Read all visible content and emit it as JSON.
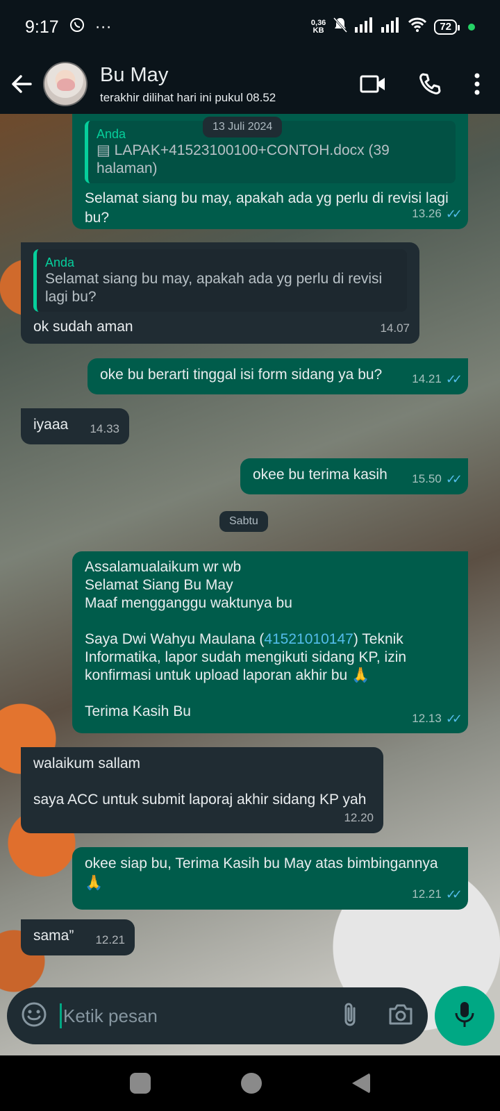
{
  "status_bar": {
    "time": "9:17",
    "more": "···",
    "net_speed": "0,36",
    "net_unit": "KB",
    "battery": "72"
  },
  "header": {
    "contact_name": "Bu May",
    "last_seen": "terakhir dilihat hari ini pukul 08.52"
  },
  "chat": {
    "date_chips": [
      "13 Juli 2024",
      "Sabtu"
    ],
    "messages": [
      {
        "dir": "out",
        "quote_author": "Anda",
        "quote_text": "▤ LAPAK+41523100100+CONTOH.docx (39 halaman)",
        "text": "Selamat siang bu may, apakah ada yg perlu di revisi lagi bu?",
        "time": "13.26",
        "ticks": "✓✓"
      },
      {
        "dir": "in",
        "quote_author": "Anda",
        "quote_text": "Selamat siang bu may, apakah ada yg perlu di revisi lagi bu?",
        "text": "ok sudah aman",
        "time": "14.07"
      },
      {
        "dir": "out",
        "text": "oke bu berarti tinggal isi form sidang ya bu?",
        "time": "14.21",
        "ticks": "✓✓"
      },
      {
        "dir": "in",
        "text": "iyaaa",
        "time": "14.33"
      },
      {
        "dir": "out",
        "text": "okee bu terima kasih",
        "time": "15.50",
        "ticks": "✓✓"
      },
      {
        "dir": "out",
        "lines": [
          "Assalamualaikum wr wb",
          "Selamat Siang Bu May",
          "Maaf mengganggu waktunya bu",
          "",
          "Saya Dwi Wahyu Maulana (",
          "41521010147",
          ") Teknik Informatika, lapor sudah mengikuti sidang KP, izin konfirmasi untuk upload laporan akhir bu 🙏",
          "",
          "Terima Kasih Bu"
        ],
        "time": "12.13",
        "ticks": "✓✓"
      },
      {
        "dir": "in",
        "lines": [
          "walaikum sallam",
          "",
          "saya ACC untuk submit laporaj akhir sidang KP yah"
        ],
        "time": "12.20"
      },
      {
        "dir": "out",
        "text": "okee siap bu, Terima Kasih bu May atas bimbingannya 🙏",
        "time": "12.21",
        "ticks": "✓✓"
      },
      {
        "dir": "in",
        "text": "sama”",
        "time": "12.21"
      }
    ]
  },
  "composer": {
    "placeholder": "Ketik pesan"
  },
  "icons": {
    "back": "arrow-left-icon",
    "video": "video-call-icon",
    "call": "phone-icon",
    "menu": "more-vertical-icon",
    "emoji": "emoji-icon",
    "attach": "paperclip-icon",
    "camera": "camera-icon",
    "mic": "microphone-icon"
  },
  "colors": {
    "outgoing_bubble": "#005c4b",
    "incoming_bubble": "#202c33",
    "accent": "#00a884",
    "read_ticks": "#53bdeb"
  }
}
